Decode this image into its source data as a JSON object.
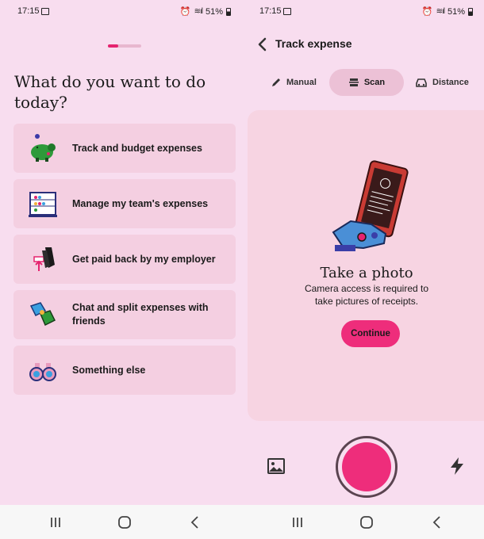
{
  "status": {
    "time": "17:15",
    "battery": "51%"
  },
  "left": {
    "progress": 0.3,
    "question": "What do you want to do today?",
    "options": [
      {
        "label": "Track and budget expenses",
        "icon": "piggy-bank-icon"
      },
      {
        "label": "Manage my team's expenses",
        "icon": "abacus-icon"
      },
      {
        "label": "Get paid back by my employer",
        "icon": "hands-money-icon"
      },
      {
        "label": "Chat and split expenses with friends",
        "icon": "high-five-icon"
      },
      {
        "label": "Something else",
        "icon": "binoculars-icon"
      }
    ]
  },
  "right": {
    "title": "Track expense",
    "tabs": [
      {
        "label": "Manual",
        "icon": "pencil-icon"
      },
      {
        "label": "Scan",
        "icon": "receipt-scan-icon",
        "selected": true
      },
      {
        "label": "Distance",
        "icon": "car-icon"
      }
    ],
    "scan": {
      "title": "Take a photo",
      "description": "Camera access is required to take pictures of receipts.",
      "continue_label": "Continue"
    }
  },
  "colors": {
    "background": "#f8ddef",
    "accent": "#ee2d7b",
    "card": "#f4cfe1"
  }
}
